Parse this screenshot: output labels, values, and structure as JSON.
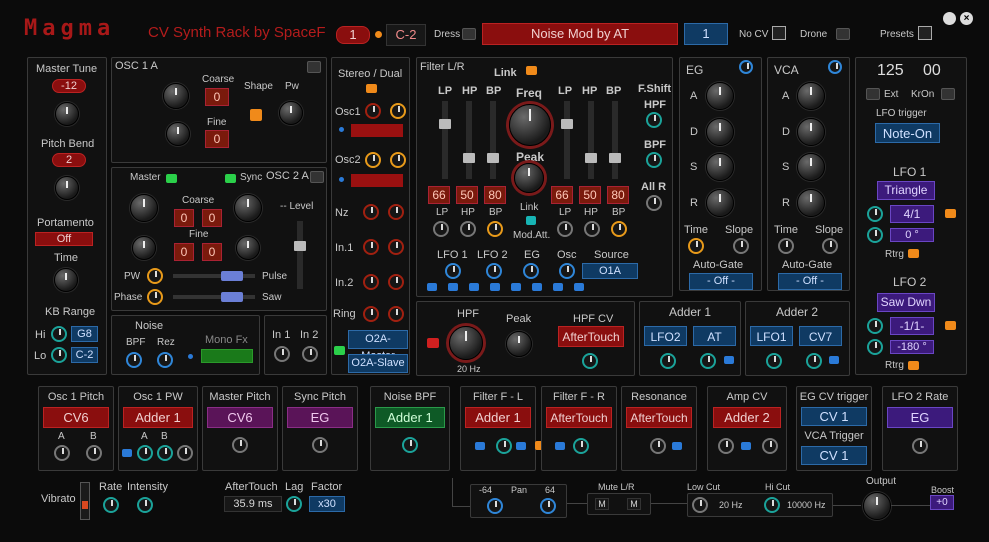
{
  "header": {
    "title": "Magma",
    "subtitle": "CV Synth Rack  by SpaceF",
    "slot_num": "1",
    "note": "C-2",
    "dress_label": "Dress",
    "patch_name": "Noise Mod by AT",
    "patch_num": "1",
    "nocv_label": "No CV",
    "drone_label": "Drone",
    "presets_label": "Presets"
  },
  "master": {
    "master_tune_label": "Master Tune",
    "master_tune_val": "-12",
    "pitch_bend_label": "Pitch Bend",
    "pitch_bend_val": "2",
    "portamento_label": "Portamento",
    "portamento_val": "Off",
    "time_label": "Time",
    "kb_range_label": "KB Range",
    "hi_label": "Hi",
    "hi_val": "G8",
    "lo_label": "Lo",
    "lo_val": "C-2"
  },
  "osc1": {
    "title": "OSC 1 A",
    "coarse_label": "Coarse",
    "coarse_val": "0",
    "fine_label": "Fine",
    "fine_val": "0",
    "shape_label": "Shape",
    "pw_label": "Pw"
  },
  "osc2": {
    "title": "OSC 2 A",
    "master_label": "Master",
    "sync_label": "Sync",
    "coarse_label": "Coarse",
    "coarse_a": "0",
    "coarse_b": "0",
    "fine_label": "Fine",
    "fine_a": "0",
    "fine_b": "0",
    "level_label": "-- Level",
    "pw_label": "PW",
    "pulse_label": "Pulse",
    "phase_label": "Phase",
    "saw_label": "Saw"
  },
  "stereo": {
    "title": "Stereo / Dual",
    "osc1": "Osc1",
    "osc2": "Osc2",
    "nz": "Nz",
    "in1": "In.1",
    "in2": "In.2",
    "ring": "Ring",
    "btn1": "O2A-Master",
    "btn2": "O2A-Slave"
  },
  "noise": {
    "title": "Noise",
    "bpf": "BPF",
    "rez": "Rez",
    "monofx": "Mono Fx"
  },
  "inputs": {
    "in1": "In 1",
    "in2": "In 2"
  },
  "filter": {
    "title": "Filter L/R",
    "link": "Link",
    "freq": "Freq",
    "peak": "Peak",
    "lp": "LP",
    "hp": "HP",
    "bp": "BP",
    "fshift": "F.Shift",
    "hpf": "HPF",
    "bpf": "BPF",
    "allr": "All R",
    "vals": [
      "66",
      "50",
      "80",
      "66",
      "50",
      "80"
    ],
    "link2": "Link",
    "modatt": "Mod.Att.",
    "lfo1": "LFO 1",
    "lfo2": "LFO 2",
    "eg": "EG",
    "osc": "Osc",
    "source": "Source",
    "source_val": "O1A"
  },
  "eg": {
    "title": "EG",
    "a": "A",
    "d": "D",
    "s": "S",
    "r": "R",
    "time": "Time",
    "slope": "Slope",
    "autogate": "Auto-Gate",
    "autogate_val": "- Off -"
  },
  "vca": {
    "title": "VCA",
    "a": "A",
    "d": "D",
    "s": "S",
    "r": "R",
    "time": "Time",
    "slope": "Slope",
    "autogate": "Auto-Gate",
    "autogate_val": "- Off -"
  },
  "lfo": {
    "bpm": "125",
    "bpm2": "00",
    "ext": "Ext",
    "kron": "KrOn",
    "trigger_label": "LFO trigger",
    "trigger_val": "Note-On",
    "lfo1_title": "LFO 1",
    "lfo1_wave": "Triangle",
    "lfo1_rate": "4/1",
    "lfo1_phase": "0 °",
    "rtrg": "Rtrg",
    "lfo2_title": "LFO 2",
    "lfo2_wave": "Saw Dwn",
    "lfo2_rate": "-1/1-",
    "lfo2_phase": "-180 °"
  },
  "hpf": {
    "title": "HPF",
    "peak": "Peak",
    "cv_label": "HPF CV",
    "cv_val": "AfterTouch",
    "freq": "20 Hz"
  },
  "adder1": {
    "title": "Adder 1",
    "a": "LFO2",
    "b": "AT"
  },
  "adder2": {
    "title": "Adder 2",
    "a": "LFO1",
    "b": "CV7"
  },
  "mod": [
    {
      "title": "Osc 1 Pitch",
      "val": "CV6",
      "a": "A",
      "b": "B"
    },
    {
      "title": "Osc 1 PW",
      "val": "Adder 1",
      "a": "A",
      "b": "B"
    },
    {
      "title": "Master Pitch",
      "val": "CV6"
    },
    {
      "title": "Sync Pitch",
      "val": "EG"
    },
    {
      "title": "Noise BPF",
      "val": "Adder 1"
    },
    {
      "title": "Filter F - L",
      "val": "Adder 1"
    },
    {
      "title": "Filter F - R",
      "val": "AfterTouch"
    },
    {
      "title": "Resonance",
      "val": "AfterTouch"
    },
    {
      "title": "Amp CV",
      "val": "Adder 2"
    },
    {
      "title": "EG CV trigger",
      "val": "CV 1",
      "title2": "VCA Trigger",
      "val2": "CV 1"
    },
    {
      "title": "LFO 2 Rate",
      "val": "EG"
    }
  ],
  "bottom": {
    "vibrato": "Vibrato",
    "rate": "Rate",
    "intensity": "Intensity",
    "aftertouch": "AfterTouch",
    "lag": "Lag",
    "factor": "Factor",
    "at_val": "35.9 ms",
    "factor_val": "x30",
    "pan_l": "-64",
    "pan": "Pan",
    "pan_r": "64",
    "mute": "Mute L/R",
    "m1": "M",
    "m2": "M",
    "lowcut": "Low Cut",
    "lowcut_val": "20 Hz",
    "hicut": "Hi Cut",
    "hicut_val": "10000 Hz",
    "output": "Output",
    "boost": "Boost",
    "boost_val": "+0"
  },
  "colors": {
    "accent_red": "#a81818",
    "accent_blue": "#0f3a63",
    "accent_orange": "#f08a1a"
  }
}
